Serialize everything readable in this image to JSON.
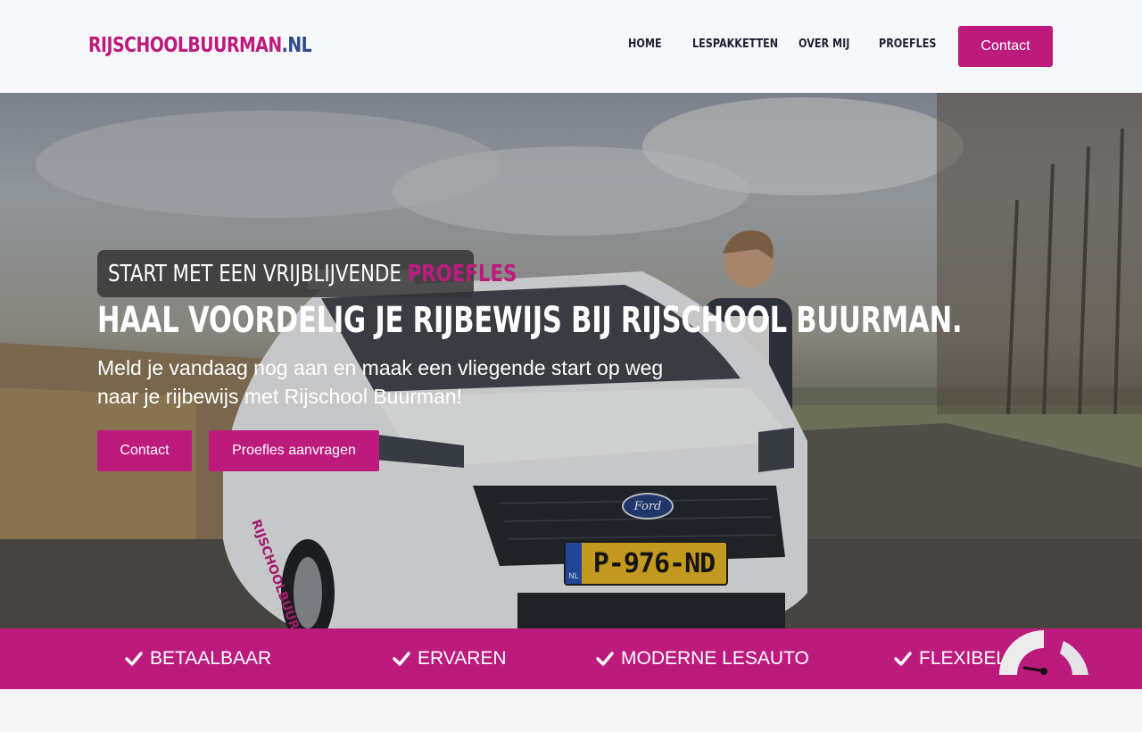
{
  "header": {
    "logo_pink": "RIJSCHOOLBUURMAN",
    "logo_blue": ".NL",
    "nav": [
      "HOME",
      "LESPAKKETTEN",
      "OVER MIJ",
      "PROEFLES"
    ],
    "contact_label": "Contact"
  },
  "hero": {
    "tagline_prefix": "START MET EEN VRIJBLIJVENDE",
    "tagline_highlight": "PROEFLES",
    "headline": "HAAL VOORDELIG JE RIJBEWIJS BIJ RIJSCHOOL BUURMAN.",
    "subtext": "Meld je vandaag nog aan en maak een vliegende start op weg naar je rijbewijs met Rijschool Buurman!",
    "btn_contact": "Contact",
    "btn_proefles": "Proefles aanvragen",
    "license_plate": "P-976-ND",
    "plate_country": "NL",
    "car_brand": "Ford"
  },
  "features": [
    "BETAALBAAR",
    "ERVAREN",
    "MODERNE LESAUTO",
    "FLEXIBEL"
  ],
  "colors": {
    "brand_pink": "#bd1a7d",
    "brand_blue": "#2d4a8a",
    "nav_text": "#1d2233"
  }
}
